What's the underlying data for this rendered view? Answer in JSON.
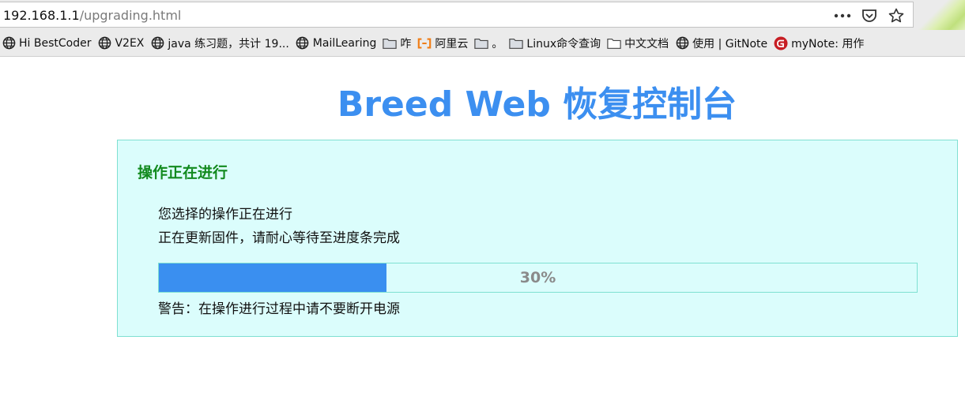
{
  "browser": {
    "url_host": "192.168.1.1",
    "url_path": "/upgrading.html",
    "actions": [
      {
        "name": "more-icon",
        "glyph": "•••"
      },
      {
        "name": "pocket-icon",
        "glyph": ""
      },
      {
        "name": "star-icon",
        "glyph": "☆"
      }
    ]
  },
  "bookmarks": [
    {
      "label": "Hi BestCoder",
      "icon": "globe-icon"
    },
    {
      "label": "V2EX",
      "icon": "globe-icon"
    },
    {
      "label": "java 练习题，共计 19...",
      "icon": "globe-icon"
    },
    {
      "label": "MailLearing",
      "icon": "globe-icon"
    },
    {
      "label": "咋",
      "icon": "folder-icon"
    },
    {
      "label": "阿里云",
      "icon": "aliyun-icon"
    },
    {
      "label": "。",
      "icon": "folder-icon"
    },
    {
      "label": "Linux命令查询",
      "icon": "folder-icon"
    },
    {
      "label": "中文文档",
      "icon": "folder-outline-icon"
    },
    {
      "label": "使用 | GitNote",
      "icon": "globe-icon"
    },
    {
      "label": "myNote: 用作",
      "icon": "gitee-icon"
    }
  ],
  "page": {
    "title": "Breed Web 恢复控制台",
    "panel_title": "操作正在进行",
    "message_1": "您选择的操作正在进行",
    "message_2": "正在更新固件，请耐心等待至进度条完成",
    "progress_label": "30%",
    "progress_percent": 30,
    "warning": "警告：在操作进行过程中请不要断开电源"
  },
  "colors": {
    "title": "#3c8ff0",
    "panel_bg": "#dbfdfc",
    "panel_border": "#7fe0d2",
    "panel_title": "#128a1e",
    "progress_fill": "#3a8ff0",
    "progress_text": "#8a8a8a"
  }
}
